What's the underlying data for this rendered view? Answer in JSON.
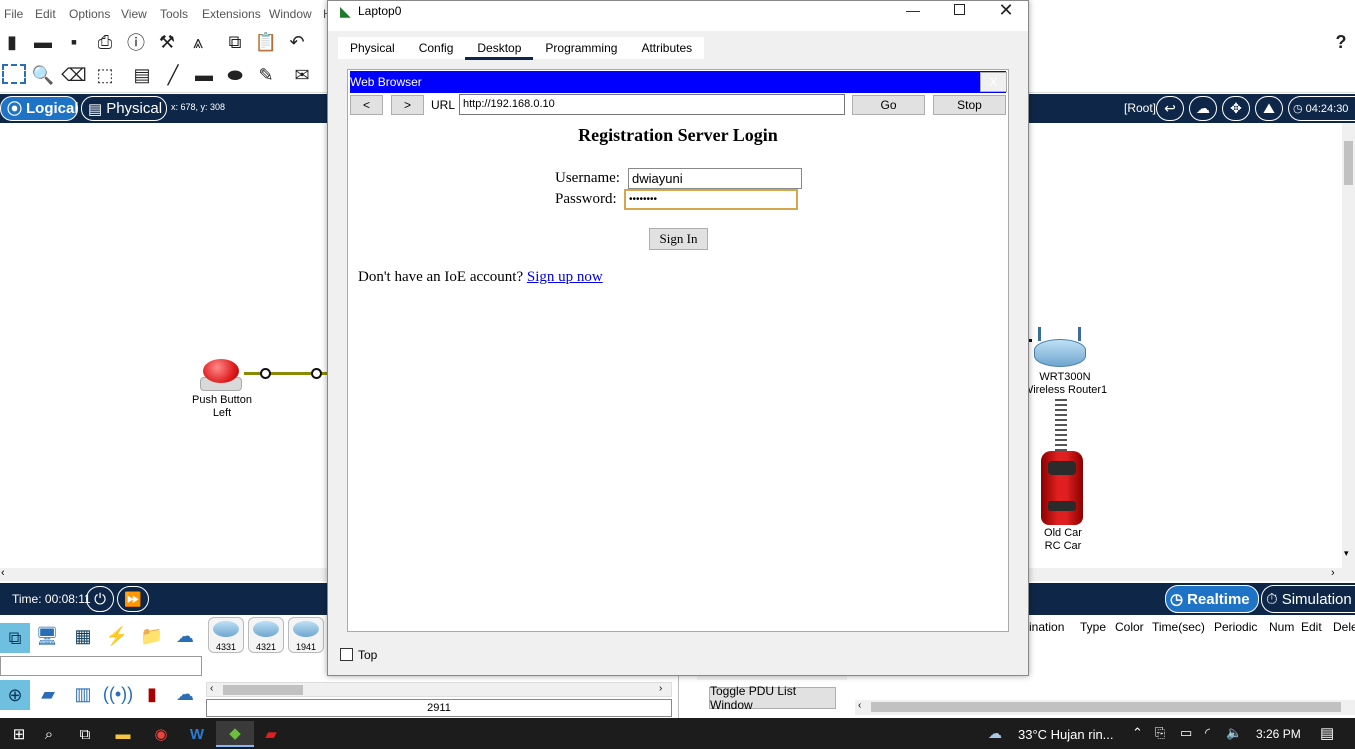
{
  "app": {
    "menu": [
      "File",
      "Edit",
      "Options",
      "View",
      "Tools",
      "Extensions",
      "Window",
      "H"
    ],
    "help_icon": "?",
    "nav": {
      "logical_label": "Logical",
      "physical_label": "Physical",
      "coords": "x: 678, y: 308",
      "root_label": "[Root]",
      "time": "04:24:30"
    },
    "workspace": {
      "push_button_label_line1": "Push Button",
      "push_button_label_line2": "Left",
      "router_label_line1": "WRT300N",
      "router_label_line2": "Wireless Router1",
      "car_label_line1": "Old Car",
      "car_label_line2": "RC Car"
    },
    "status": {
      "time_label": "Time: 00:08:11",
      "realtime_label": "Realtime",
      "simulation_label": "Simulation"
    },
    "device_panel": {
      "models": [
        "4331",
        "4321",
        "1941"
      ],
      "selected_model": "2911"
    },
    "pdu": {
      "columns": [
        "ination",
        "Type",
        "Color",
        "Time(sec)",
        "Periodic",
        "Num",
        "Edit",
        "Dele"
      ],
      "toggle_label": "Toggle PDU List Window"
    }
  },
  "taskbar": {
    "weather": "33°C  Hujan rin...",
    "clock": "3:26 PM"
  },
  "laptop_window": {
    "title": "Laptop0",
    "tabs": [
      "Physical",
      "Config",
      "Desktop",
      "Programming",
      "Attributes"
    ],
    "active_tab": "Desktop",
    "top_checkbox_label": "Top",
    "browser": {
      "title": "Web Browser",
      "close": "X",
      "back": "<",
      "forward": ">",
      "url_label": "URL",
      "url": "http://192.168.0.10",
      "go": "Go",
      "stop": "Stop",
      "page": {
        "heading": "Registration Server Login",
        "username_label": "Username:",
        "username_value": "dwiayuni",
        "password_label": "Password:",
        "password_value": "••••••••",
        "signin_label": "Sign In",
        "signup_text": "Don't have an IoE account?",
        "signup_link": "Sign up now"
      }
    }
  },
  "colors": {
    "nav_bg": "#0e2748",
    "browser_titlebar": "#0000ff",
    "link": "#0000ee",
    "cable": "#8a8a00"
  }
}
